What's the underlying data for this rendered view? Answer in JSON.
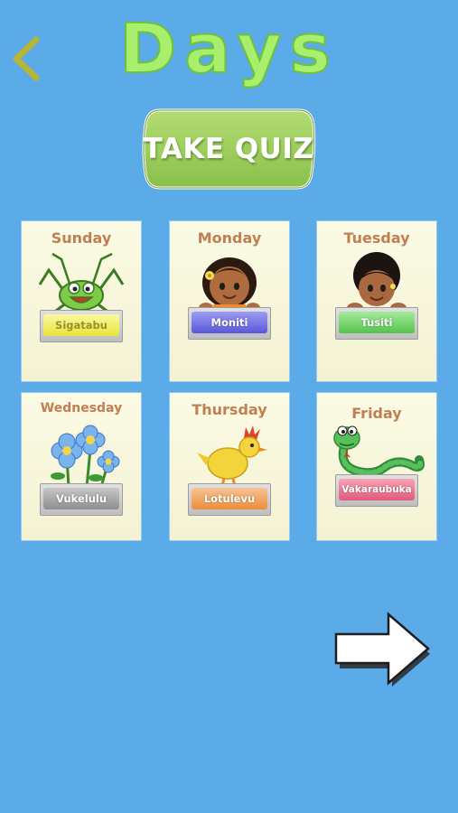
{
  "header": {
    "title": "Days"
  },
  "quiz": {
    "label": "TAKE QUIZ"
  },
  "days": [
    {
      "name": "Sunday",
      "translation": "Sigatabu",
      "badge_color": "#f1ee56",
      "icon": "grasshopper-icon"
    },
    {
      "name": "Monday",
      "translation": "Moniti",
      "badge_color": "#6f6fe6",
      "icon": "girl-icon"
    },
    {
      "name": "Tuesday",
      "translation": "Tusiti",
      "badge_color": "#6bd165",
      "icon": "boy-icon"
    },
    {
      "name": "Wednesday",
      "translation": "Vukelulu",
      "badge_color": "#9a9a9a",
      "icon": "flowers-icon"
    },
    {
      "name": "Thursday",
      "translation": "Lotulevu",
      "badge_color": "#f2a157",
      "icon": "chick-icon"
    },
    {
      "name": "Friday",
      "translation": "Vakaraubuka",
      "badge_color": "#ee6f8d",
      "icon": "snake-icon"
    }
  ],
  "colors": {
    "background": "#5aabe8",
    "title_green": "#a8ef6e",
    "card": "#f8f7dc",
    "day_label": "#c07f52",
    "back_arrow": "#b6b535"
  }
}
